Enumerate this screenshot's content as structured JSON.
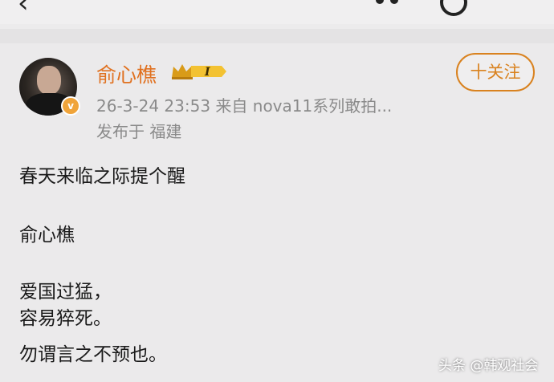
{
  "post": {
    "author": {
      "name": "俞心樵",
      "level_badge": "I",
      "verified_badge": "v"
    },
    "meta": "26-3-24 23:53  来自 nova11系列敢拍...",
    "location": "发布于 福建",
    "follow_label": "十关注",
    "lines": [
      "春天来临之际提个醒",
      "俞心樵",
      "爱国过猛，",
      "容易猝死。",
      "勿谓言之不预也。"
    ]
  },
  "watermark": "头条 @韩观社会",
  "colors": {
    "accent": "#e07120",
    "follow": "#d9821f",
    "meta_text": "#8a8a8a",
    "background": "#ebeaeb"
  }
}
